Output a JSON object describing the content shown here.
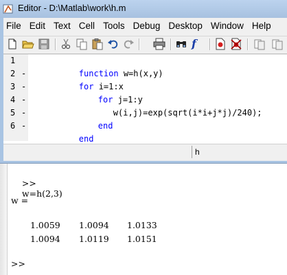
{
  "window": {
    "title": "Editor - D:\\Matlab\\work\\h.m"
  },
  "menubar": {
    "items": [
      "File",
      "Edit",
      "Text",
      "Cell",
      "Tools",
      "Debug",
      "Desktop",
      "Window",
      "Help"
    ]
  },
  "toolbar": {
    "buttons": [
      "new-file-icon",
      "open-folder-icon",
      "save-icon",
      "cut-icon",
      "copy-icon",
      "paste-icon",
      "undo-icon",
      "redo-icon",
      "print-icon",
      "find-icon",
      "function-icon",
      "set-breakpoint-icon",
      "clear-breakpoint-icon",
      "step-icon",
      "step-in-icon"
    ],
    "function_label": "f"
  },
  "editor": {
    "lines": [
      {
        "number": "1",
        "marker": "",
        "keyword": "function",
        "text": " w=h(x,y)",
        "indent": 0
      },
      {
        "number": "2",
        "marker": "-",
        "keyword": "for",
        "text": " i=1:x",
        "indent": 0
      },
      {
        "number": "3",
        "marker": "-",
        "keyword": "for",
        "text": " j=1:y",
        "indent": 1
      },
      {
        "number": "4",
        "marker": "-",
        "keyword": "",
        "text": "w(i,j)=exp(sqrt(i*i+j*j)/240);",
        "indent": 2
      },
      {
        "number": "5",
        "marker": "-",
        "keyword": "end",
        "text": "",
        "indent": 1
      },
      {
        "number": "6",
        "marker": "-",
        "keyword": "end",
        "text": "",
        "indent": 0
      }
    ]
  },
  "statusbar": {
    "function_name": "h"
  },
  "console": {
    "command_prompt": ">>",
    "command": "w=h(2,3)",
    "result_label": "w =",
    "result_rows": [
      [
        "1.0059",
        "1.0094",
        "1.0133"
      ],
      [
        "1.0094",
        "1.0119",
        "1.0151"
      ]
    ],
    "final_prompt": ">>"
  }
}
